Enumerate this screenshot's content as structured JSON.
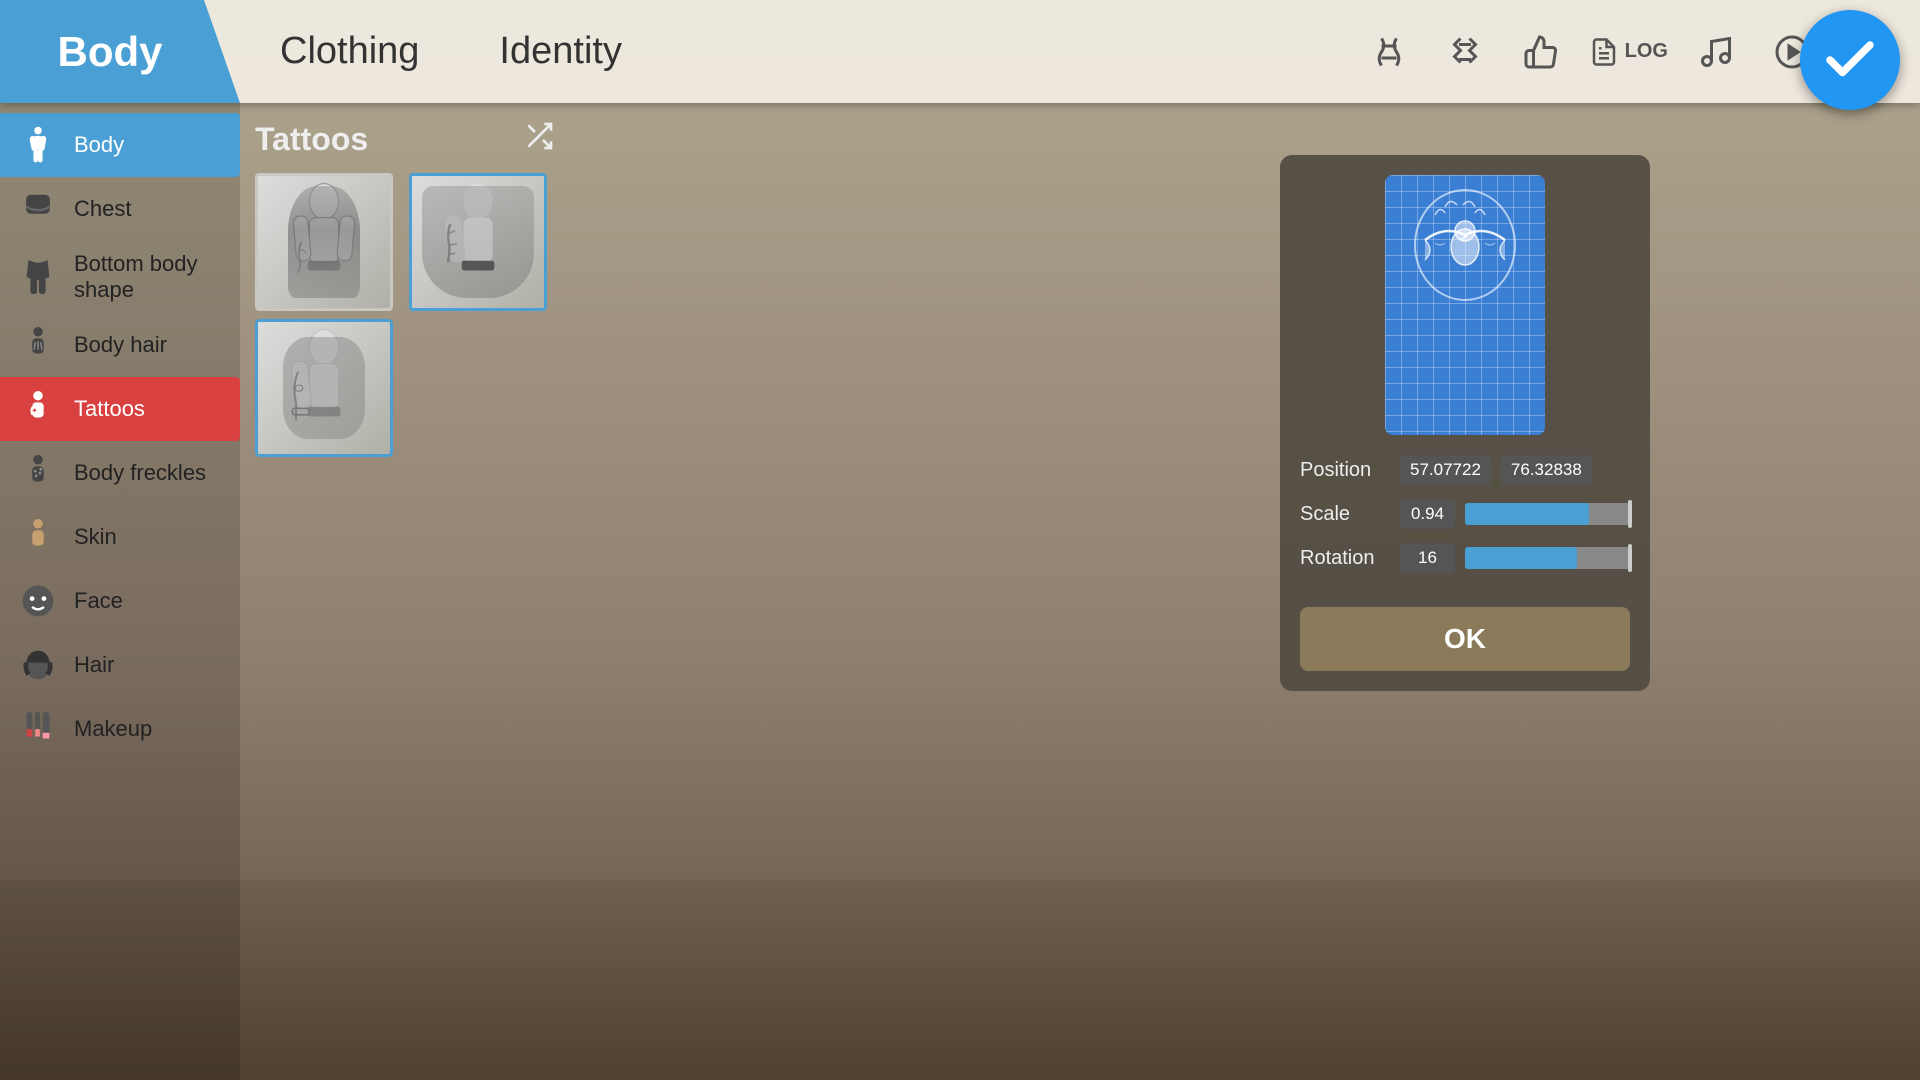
{
  "topbar": {
    "body_tab": "Body",
    "clothing_tab": "Clothing",
    "identity_tab": "Identity",
    "log_label": "LOG"
  },
  "sidebar": {
    "items": [
      {
        "label": "Body",
        "icon": "body-icon",
        "active": false,
        "active_blue": true
      },
      {
        "label": "Chest",
        "icon": "chest-icon",
        "active": false
      },
      {
        "label": "Bottom body shape",
        "icon": "bottom-body-icon",
        "active": false
      },
      {
        "label": "Body hair",
        "icon": "body-hair-icon",
        "active": false
      },
      {
        "label": "Tattoos",
        "icon": "tattoos-icon",
        "active": true
      },
      {
        "label": "Body freckles",
        "icon": "body-freckles-icon",
        "active": false
      },
      {
        "label": "Skin",
        "icon": "skin-icon",
        "active": false
      },
      {
        "label": "Face",
        "icon": "face-icon",
        "active": false
      },
      {
        "label": "Hair",
        "icon": "hair-icon",
        "active": false
      },
      {
        "label": "Makeup",
        "icon": "makeup-icon",
        "active": false
      }
    ]
  },
  "tattoos_panel": {
    "title": "Tattoos",
    "shuffle_icon": "shuffle-icon",
    "items": [
      {
        "id": 1,
        "selected": false
      },
      {
        "id": 2,
        "selected": true
      },
      {
        "id": 3,
        "selected": true
      }
    ]
  },
  "placement_panel": {
    "position_label": "Position",
    "position_x": "57.07722",
    "position_y": "76.32838",
    "scale_label": "Scale",
    "scale_value": "0.94",
    "scale_percent": 75,
    "rotation_label": "Rotation",
    "rotation_value": "16",
    "rotation_percent": 68,
    "ok_label": "OK"
  }
}
